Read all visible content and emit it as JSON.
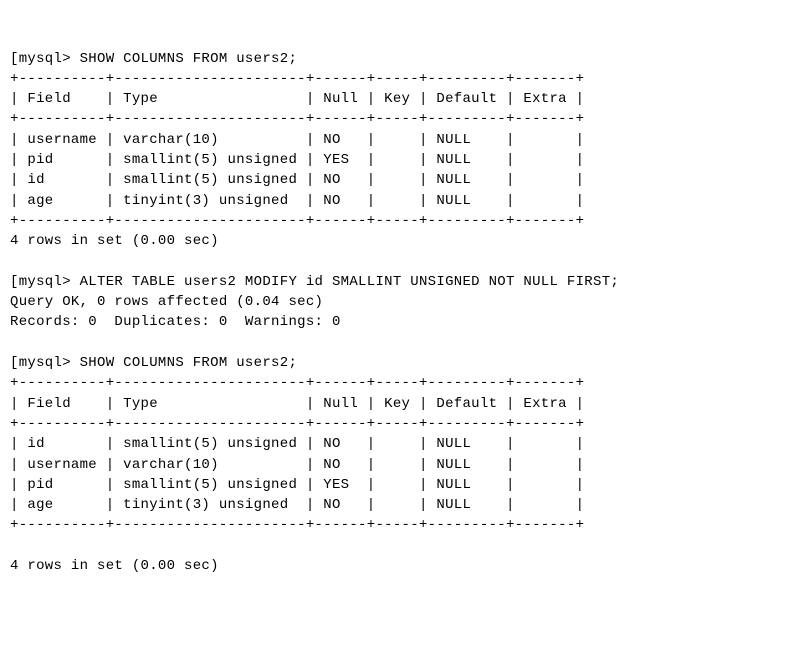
{
  "session": {
    "prompt": "mysql>",
    "cmd1": "SHOW COLUMNS FROM users2;",
    "cmd2": "ALTER TABLE users2 MODIFY id SMALLINT UNSIGNED NOT NULL FIRST;",
    "cmd3": "SHOW COLUMNS FROM users2;",
    "alter_result_line1": "Query OK, 0 rows affected (0.04 sec)",
    "alter_result_line2": "Records: 0  Duplicates: 0  Warnings: 0",
    "rows_footer": "4 rows in set (0.00 sec)"
  },
  "table1": {
    "headers": [
      "Field",
      "Type",
      "Null",
      "Key",
      "Default",
      "Extra"
    ],
    "rows": [
      {
        "Field": "username",
        "Type": "varchar(10)",
        "Null": "NO",
        "Key": "",
        "Default": "NULL",
        "Extra": ""
      },
      {
        "Field": "pid",
        "Type": "smallint(5) unsigned",
        "Null": "YES",
        "Key": "",
        "Default": "NULL",
        "Extra": ""
      },
      {
        "Field": "id",
        "Type": "smallint(5) unsigned",
        "Null": "NO",
        "Key": "",
        "Default": "NULL",
        "Extra": ""
      },
      {
        "Field": "age",
        "Type": "tinyint(3) unsigned",
        "Null": "NO",
        "Key": "",
        "Default": "NULL",
        "Extra": ""
      }
    ]
  },
  "table2": {
    "headers": [
      "Field",
      "Type",
      "Null",
      "Key",
      "Default",
      "Extra"
    ],
    "rows": [
      {
        "Field": "id",
        "Type": "smallint(5) unsigned",
        "Null": "NO",
        "Key": "",
        "Default": "NULL",
        "Extra": ""
      },
      {
        "Field": "username",
        "Type": "varchar(10)",
        "Null": "NO",
        "Key": "",
        "Default": "NULL",
        "Extra": ""
      },
      {
        "Field": "pid",
        "Type": "smallint(5) unsigned",
        "Null": "YES",
        "Key": "",
        "Default": "NULL",
        "Extra": ""
      },
      {
        "Field": "age",
        "Type": "tinyint(3) unsigned",
        "Null": "NO",
        "Key": "",
        "Default": "NULL",
        "Extra": ""
      }
    ]
  },
  "chart_data": {
    "type": "table",
    "description": "Two MySQL DESCRIBE-style tables for users2, before and after ALTER TABLE MODIFY id ... FIRST",
    "before": [
      [
        "username",
        "varchar(10)",
        "NO",
        "",
        "NULL",
        ""
      ],
      [
        "pid",
        "smallint(5) unsigned",
        "YES",
        "",
        "NULL",
        ""
      ],
      [
        "id",
        "smallint(5) unsigned",
        "NO",
        "",
        "NULL",
        ""
      ],
      [
        "age",
        "tinyint(3) unsigned",
        "NO",
        "",
        "NULL",
        ""
      ]
    ],
    "after": [
      [
        "id",
        "smallint(5) unsigned",
        "NO",
        "",
        "NULL",
        ""
      ],
      [
        "username",
        "varchar(10)",
        "NO",
        "",
        "NULL",
        ""
      ],
      [
        "pid",
        "smallint(5) unsigned",
        "YES",
        "",
        "NULL",
        ""
      ],
      [
        "age",
        "tinyint(3) unsigned",
        "NO",
        "",
        "NULL",
        ""
      ]
    ],
    "columns": [
      "Field",
      "Type",
      "Null",
      "Key",
      "Default",
      "Extra"
    ]
  },
  "widths": {
    "Field": 8,
    "Type": 20,
    "Null": 4,
    "Key": 3,
    "Default": 7,
    "Extra": 5
  }
}
